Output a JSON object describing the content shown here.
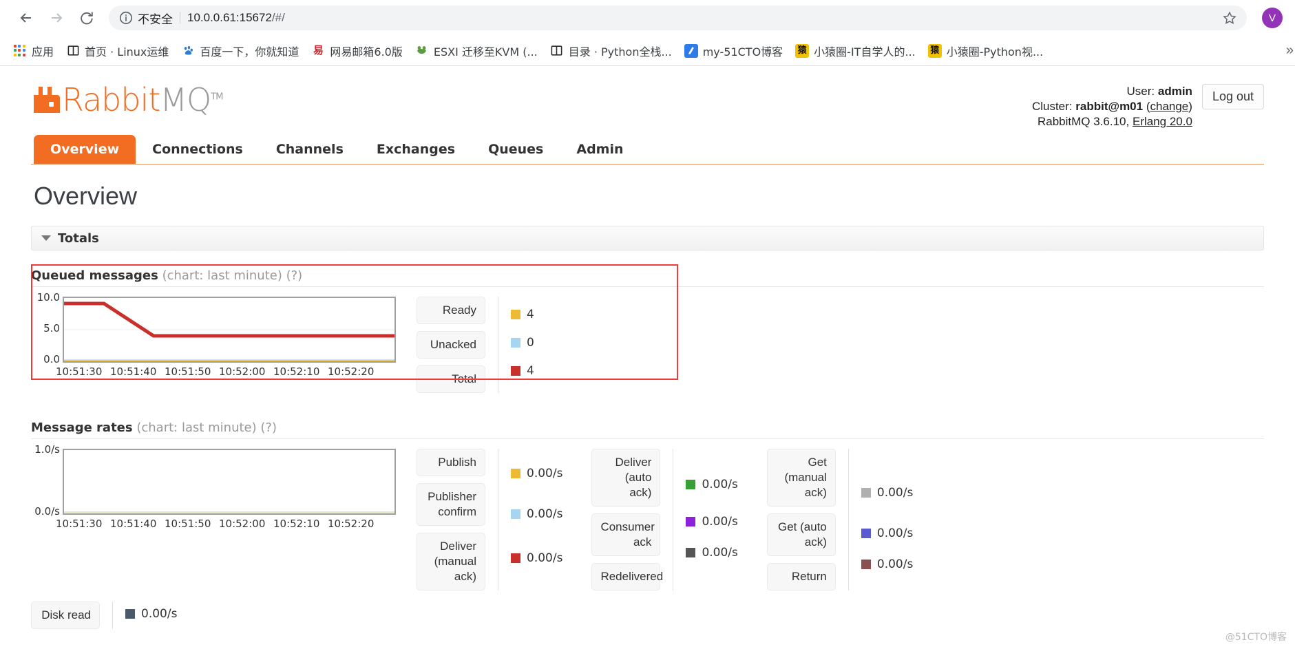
{
  "browser": {
    "security_label": "不安全",
    "url_host": "10.0.0.61:15672",
    "url_path": "/#/",
    "back_icon": "back-arrow-icon",
    "forward_icon": "forward-arrow-icon",
    "reload_icon": "reload-icon",
    "info_icon": "info-circle-icon",
    "star_icon": "star-icon",
    "avatar_initial": "V",
    "bookmarks": [
      {
        "label": "应用",
        "icon": "apps-grid-icon"
      },
      {
        "label": "首页 · Linux运维",
        "icon": "book-icon"
      },
      {
        "label": "百度一下，你就知道",
        "icon": "baidu-paw-icon"
      },
      {
        "label": "网易邮箱6.0版",
        "icon": "netease-mail-icon"
      },
      {
        "label": "ESXI 迁移至KVM (...",
        "icon": "frog-icon"
      },
      {
        "label": "目录 · Python全栈...",
        "icon": "book-icon"
      },
      {
        "label": "my-51CTO博客",
        "icon": "pen-icon"
      },
      {
        "label": "小猿圈-IT自学人的...",
        "icon": "yuan-icon"
      },
      {
        "label": "小猿圈-Python视...",
        "icon": "yuan-icon"
      }
    ],
    "overflow_icon": "chevron-right-icon"
  },
  "app": {
    "logo_primary": "Rabbit",
    "logo_secondary": "MQ",
    "logo_tm": "TM",
    "user_label": "User:",
    "user_name": "admin",
    "cluster_label": "Cluster:",
    "cluster_name": "rabbit@m01",
    "cluster_change": "change",
    "version_line": "RabbitMQ 3.6.10, Erlang 20.0",
    "version_product": "RabbitMQ 3.6.10,",
    "version_erlang": "Erlang 20.0",
    "logout_label": "Log out",
    "tabs": [
      {
        "label": "Overview",
        "active": true
      },
      {
        "label": "Connections",
        "active": false
      },
      {
        "label": "Channels",
        "active": false
      },
      {
        "label": "Exchanges",
        "active": false
      },
      {
        "label": "Queues",
        "active": false
      },
      {
        "label": "Admin",
        "active": false
      }
    ],
    "page_title": "Overview",
    "totals_label": "Totals",
    "accent_color": "#f26c22"
  },
  "queued_messages": {
    "title": "Queued messages",
    "subtitle": "(chart: last minute)",
    "help": "(?)",
    "legend": [
      {
        "label": "Ready",
        "value": "4",
        "color": "#edba35"
      },
      {
        "label": "Unacked",
        "value": "0",
        "color": "#a6d5f2"
      },
      {
        "label": "Total",
        "value": "4",
        "color": "#c9302c"
      }
    ]
  },
  "message_rates": {
    "title": "Message rates",
    "subtitle": "(chart: last minute)",
    "help": "(?)",
    "columns": [
      [
        {
          "label": "Publish",
          "value": "0.00/s",
          "color": "#edba35"
        },
        {
          "label": "Publisher confirm",
          "value": "0.00/s",
          "color": "#a6d5f2"
        },
        {
          "label": "Deliver (manual ack)",
          "value": "0.00/s",
          "color": "#c9302c"
        }
      ],
      [
        {
          "label": "Deliver (auto ack)",
          "value": "0.00/s",
          "color": "#35a135"
        },
        {
          "label": "Consumer ack",
          "value": "0.00/s",
          "color": "#8c23d9"
        },
        {
          "label": "Redelivered",
          "value": "0.00/s",
          "color": "#555555"
        }
      ],
      [
        {
          "label": "Get (manual ack)",
          "value": "0.00/s",
          "color": "#b0b0b0"
        },
        {
          "label": "Get (auto ack)",
          "value": "0.00/s",
          "color": "#5b5bd1"
        },
        {
          "label": "Return",
          "value": "0.00/s",
          "color": "#8a5050"
        }
      ]
    ]
  },
  "bottom_partial": {
    "label": "Disk read",
    "value": "0.00/s",
    "color": "#4a5a6a"
  },
  "watermark": "@51CTO博客",
  "chart_data": [
    {
      "type": "line",
      "title": "Queued messages",
      "subtitle": "chart: last minute",
      "xlabel": "",
      "ylabel": "",
      "ylim": [
        0,
        10
      ],
      "yticks": [
        "0.0",
        "5.0",
        "10.0"
      ],
      "xticks": [
        "10:51:30",
        "10:51:40",
        "10:51:50",
        "10:52:00",
        "10:52:10",
        "10:52:20"
      ],
      "grid": true,
      "legend_position": "right",
      "series": [
        {
          "name": "Total",
          "color": "#c9302c",
          "x": [
            "10:51:30",
            "10:51:35",
            "10:51:40",
            "10:51:50",
            "10:52:00",
            "10:52:10",
            "10:52:20",
            "10:52:25"
          ],
          "values": [
            9,
            9,
            4,
            4,
            4,
            4,
            4,
            4
          ]
        },
        {
          "name": "Ready",
          "color": "#edba35",
          "x": [
            "10:51:30",
            "10:52:25"
          ],
          "values": [
            0,
            0
          ]
        },
        {
          "name": "Unacked",
          "color": "#a6d5f2",
          "x": [
            "10:51:30",
            "10:52:25"
          ],
          "values": [
            0,
            0
          ]
        }
      ]
    },
    {
      "type": "line",
      "title": "Message rates",
      "subtitle": "chart: last minute",
      "xlabel": "",
      "ylabel": "",
      "ylim": [
        0,
        1
      ],
      "yticks": [
        "0.0/s",
        "1.0/s"
      ],
      "xticks": [
        "10:51:30",
        "10:51:40",
        "10:51:50",
        "10:52:00",
        "10:52:10",
        "10:52:20"
      ],
      "grid": false,
      "legend_position": "right",
      "series": [
        {
          "name": "Publish",
          "color": "#edba35",
          "x": [
            "10:51:30",
            "10:52:25"
          ],
          "values": [
            0,
            0
          ]
        },
        {
          "name": "Publisher confirm",
          "color": "#a6d5f2",
          "x": [
            "10:51:30",
            "10:52:25"
          ],
          "values": [
            0,
            0
          ]
        },
        {
          "name": "Deliver (manual ack)",
          "color": "#c9302c",
          "x": [
            "10:51:30",
            "10:52:25"
          ],
          "values": [
            0,
            0
          ]
        },
        {
          "name": "Deliver (auto ack)",
          "color": "#35a135",
          "x": [
            "10:51:30",
            "10:52:25"
          ],
          "values": [
            0,
            0
          ]
        },
        {
          "name": "Consumer ack",
          "color": "#8c23d9",
          "x": [
            "10:51:30",
            "10:52:25"
          ],
          "values": [
            0,
            0
          ]
        },
        {
          "name": "Redelivered",
          "color": "#555555",
          "x": [
            "10:51:30",
            "10:52:25"
          ],
          "values": [
            0,
            0
          ]
        },
        {
          "name": "Get (manual ack)",
          "color": "#b0b0b0",
          "x": [
            "10:51:30",
            "10:52:25"
          ],
          "values": [
            0,
            0
          ]
        },
        {
          "name": "Get (auto ack)",
          "color": "#5b5bd1",
          "x": [
            "10:51:30",
            "10:52:25"
          ],
          "values": [
            0,
            0
          ]
        },
        {
          "name": "Return",
          "color": "#8a5050",
          "x": [
            "10:51:30",
            "10:52:25"
          ],
          "values": [
            0,
            0
          ]
        }
      ]
    }
  ]
}
